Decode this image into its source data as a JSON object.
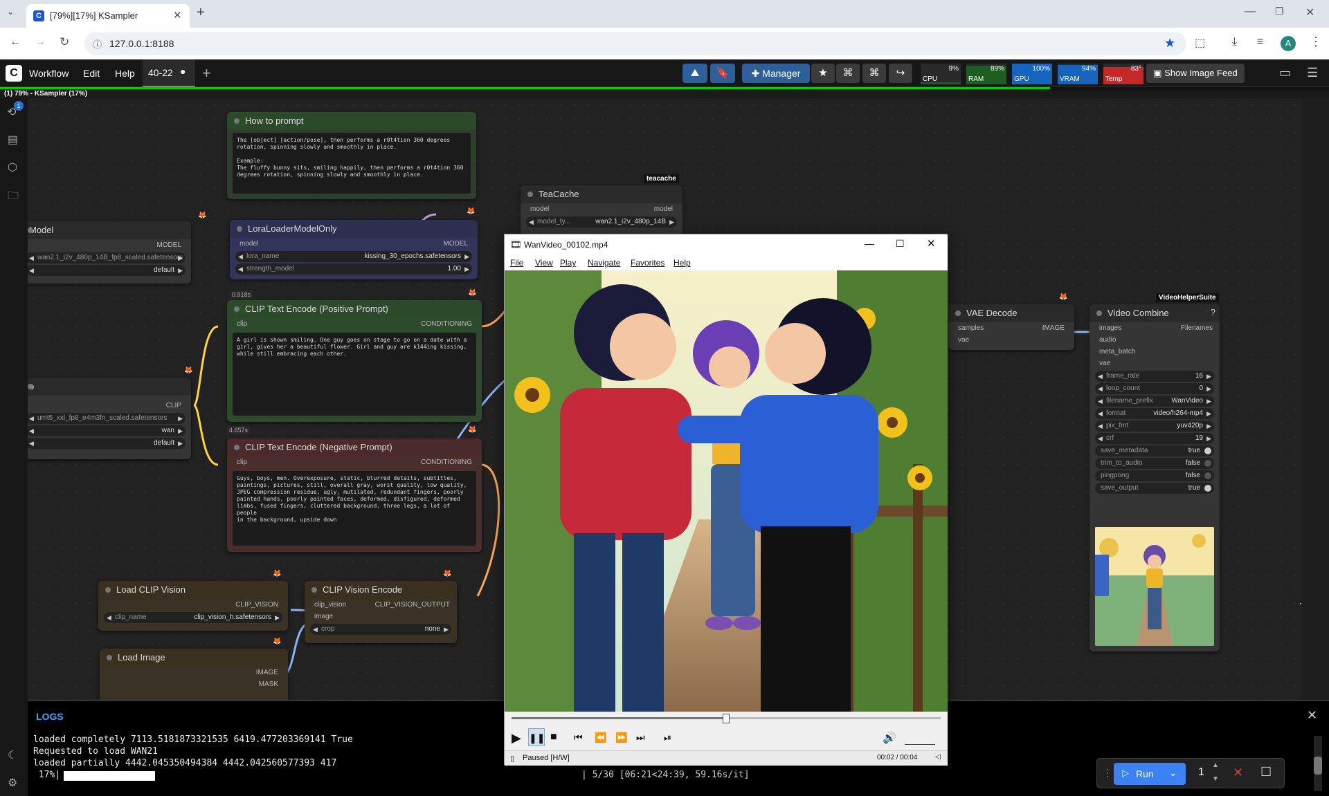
{
  "browser": {
    "tab_title": "[79%][17%] KSampler",
    "url": "127.0.0.1:8188",
    "profile_initial": "A"
  },
  "menu": {
    "workflow": "Workflow",
    "edit": "Edit",
    "help": "Help",
    "workflow_tab": "40-22"
  },
  "toolbar": {
    "manager": "Manager",
    "show_image_feed": "Show Image Feed"
  },
  "meters": [
    {
      "label": "CPU",
      "value": "9%",
      "color": "#1b5e20",
      "fill": 0.09
    },
    {
      "label": "RAM",
      "value": "89%",
      "color": "#1b5e20",
      "fill": 0.89
    },
    {
      "label": "GPU",
      "value": "100%",
      "color": "#1565c0",
      "fill": 1.0
    },
    {
      "label": "VRAM",
      "value": "94%",
      "color": "#1565c0",
      "fill": 0.94
    },
    {
      "label": "Temp",
      "value": "83°",
      "color": "#c62828",
      "fill": 0.83
    }
  ],
  "progress": {
    "text": "(1) 79% - KSampler (17%)",
    "overall": 0.79,
    "node": 0.17
  },
  "queue_badge": "1",
  "nodes": {
    "how_to_prompt": {
      "title": "How to prompt",
      "text": "The [object] [action/pose], then performs a r0t4tion 360 degrees\nrotation, spinning slowly and smoothly in place.\n\nExample:\nThe fluffy bunny sits, smiling happily, then performs a r0t4tion 360\ndegrees rotation, spinning slowly and smoothly in place."
    },
    "model": {
      "title": "Model",
      "out": "MODEL",
      "w1": "wan2.1_i2v_480p_14B_fp8_scaled.safetensors",
      "w2": "default"
    },
    "lora": {
      "title": "LoraLoaderModelOnly",
      "in": "model",
      "out": "MODEL",
      "k1": "lora_name",
      "v1": "kissing_30_epochs.safetensors",
      "k2": "strength_model",
      "v2": "1.00",
      "time": "0.918s"
    },
    "teacache": {
      "badge": "teacache",
      "title": "TeaCache",
      "in": "model",
      "out": "model",
      "k1": "model_ty...",
      "v1": "wan2.1_i2v_480p_14B"
    },
    "clip_loader": {
      "title": "o",
      "out": "CLIP",
      "w1": "umt5_xxl_fp8_e4m3fn_scaled.safetensors",
      "w2": "wan",
      "w3": "default"
    },
    "pos": {
      "title": "CLIP Text Encode (Positive Prompt)",
      "in": "clip",
      "out": "CONDITIONING",
      "text": "A girl is shown smiling. One guy goes on stage to go on a date with a\ngirl, gives her a beautiful flower. Girl and guy are k144ing kissing,\nwhile still embracing each other.",
      "time": "4.657s"
    },
    "neg": {
      "title": "CLIP Text Encode (Negative Prompt)",
      "in": "clip",
      "out": "CONDITIONING",
      "text": "Guys, boys, men. Overexposure, static, blurred details, subtitles,\npaintings, pictures, still, overall gray, worst quality, low quality,\nJPEG compression residue, ugly, mutilated, redundant fingers, poorly\npainted hands, poorly painted faces, deformed, disfigured, deformed\nlimbs, fused fingers, cluttered background, three legs, a lot of people\nin the background, upside down"
    },
    "clip_vision": {
      "title": "Load CLIP Vision",
      "out": "CLIP_VISION",
      "k1": "clip_name",
      "v1": "clip_vision_h.safetensors"
    },
    "cve": {
      "title": "CLIP Vision Encode",
      "in1": "clip_vision",
      "in2": "image",
      "out": "CLIP_VISION_OUTPUT",
      "k1": "crop",
      "v1": "none"
    },
    "load_image": {
      "title": "Load Image",
      "out1": "IMAGE",
      "out2": "MASK"
    },
    "vae_decode": {
      "title": "VAE Decode",
      "in1": "samples",
      "in2": "vae",
      "out": "IMAGE"
    },
    "video_combine": {
      "badge": "VideoHelperSuite",
      "title": "Video Combine",
      "in": [
        "images",
        "audio",
        "meta_batch",
        "vae"
      ],
      "out": "Filenames",
      "widgets": [
        [
          "frame_rate",
          "16"
        ],
        [
          "loop_count",
          "0"
        ],
        [
          "filename_prefix",
          "WanVideo"
        ],
        [
          "format",
          "video/h264-mp4"
        ],
        [
          "pix_fmt",
          "yuv420p"
        ],
        [
          "crf",
          "19"
        ]
      ],
      "toggles": [
        [
          "save_metadata",
          "true"
        ],
        [
          "trim_to_audio",
          "false"
        ],
        [
          "pingpong",
          "false"
        ],
        [
          "save_output",
          "true"
        ]
      ]
    }
  },
  "video": {
    "title": "WanVideo_00102.mp4",
    "menu": [
      "File",
      "View",
      "Play",
      "Navigate",
      "Favorites",
      "Help"
    ],
    "status": "Paused [H/W]",
    "time": "00:02 / 00:04",
    "position": 0.5
  },
  "logs": {
    "title": "LOGS",
    "lines": [
      "loaded completely 7113.5181873321535 6419.477203369141 True",
      "Requested to load WAN21",
      "loaded partially 4442.045350494384 4442.042560577393 417",
      " 17%|"
    ],
    "progress_tail": "| 5/30 [06:21<24:39, 59.16s/it]"
  },
  "run": {
    "label": "Run",
    "count": "1"
  }
}
